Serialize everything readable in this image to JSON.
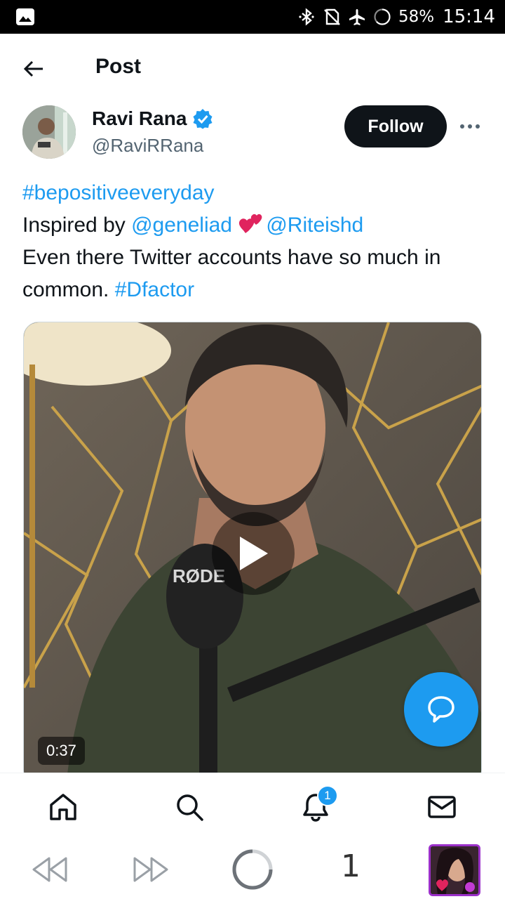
{
  "status_bar": {
    "battery": "58%",
    "time": "15:14"
  },
  "header": {
    "title": "Post",
    "back_icon": "arrow-left-icon"
  },
  "author": {
    "name": "Ravi Rana",
    "handle": "@RaviRRana",
    "verified": true,
    "follow_label": "Follow"
  },
  "post": {
    "line1_hashtag": "#bepositiveeveryday",
    "line2_prefix": "Inspired by ",
    "line2_mention1": "@geneliad",
    "line2_mention2": "@Riteishd",
    "line3_text": "Even there Twitter accounts have so much in common. ",
    "line3_hashtag": "#Dfactor"
  },
  "video": {
    "duration": "0:37"
  },
  "tabbar": {
    "items": [
      "home-icon",
      "search-icon",
      "notifications-icon",
      "messages-icon"
    ],
    "notification_count": "1"
  },
  "browser_bar": {
    "tab_count": "1"
  },
  "colors": {
    "accent": "#1d9bf0",
    "text": "#0f1419",
    "secondary_text": "#536471",
    "follow_bg": "#0f1419"
  }
}
